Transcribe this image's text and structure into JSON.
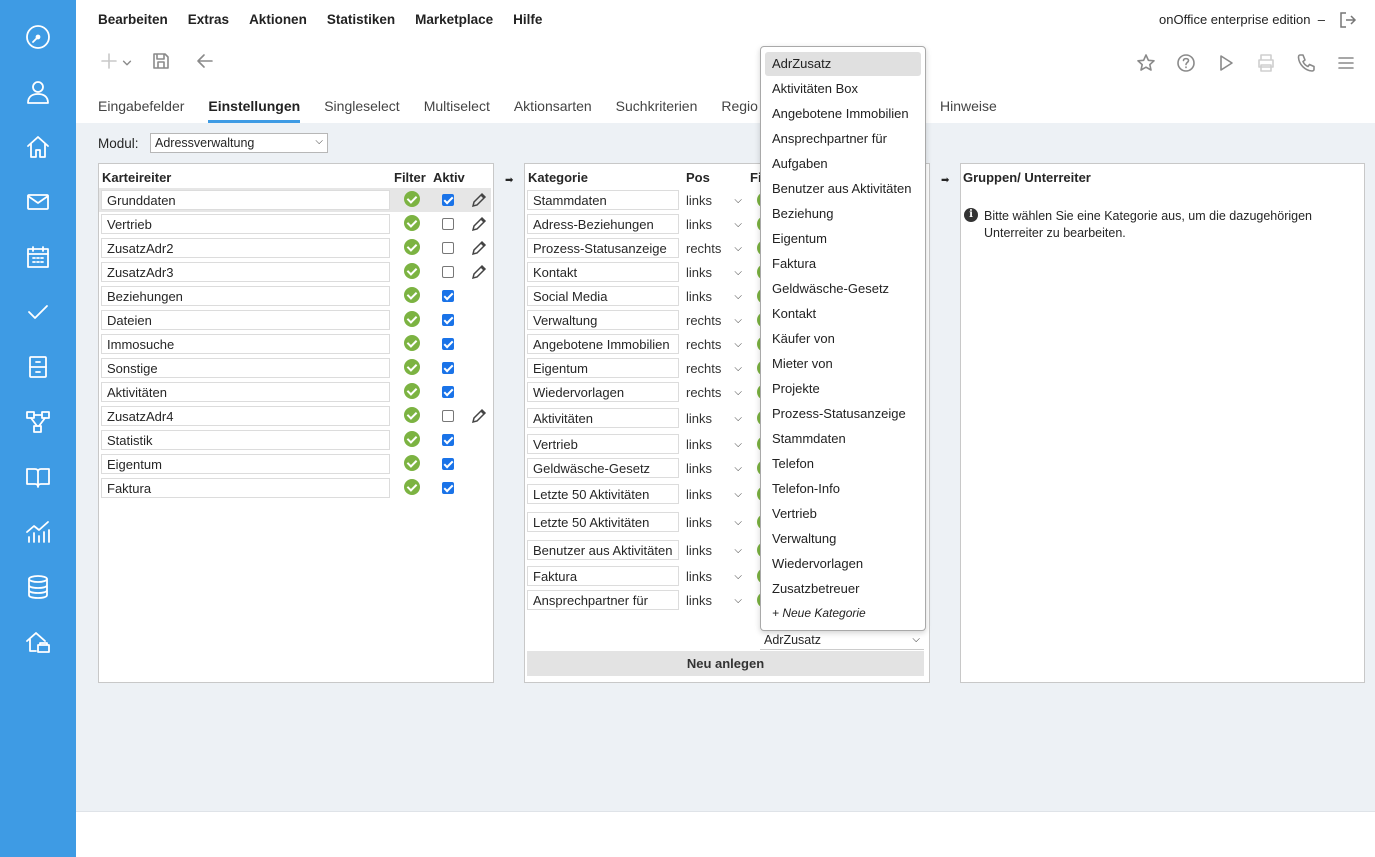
{
  "sidebar": {
    "icons": [
      "dashboard-icon",
      "user-icon",
      "home-icon",
      "mail-icon",
      "calendar-icon",
      "check-icon",
      "filing-cabinet-icon",
      "workflow-icon",
      "book-icon",
      "statistics-icon",
      "database-icon",
      "property-portal-icon"
    ]
  },
  "menu": {
    "items": [
      "Bearbeiten",
      "Extras",
      "Aktionen",
      "Statistiken",
      "Marketplace",
      "Hilfe"
    ],
    "edition": "onOffice enterprise edition",
    "edition_separator": "–"
  },
  "tabs": {
    "items": [
      "Eingabefelder",
      "Einstellungen",
      "Singleselect",
      "Multiselect",
      "Aktionsarten",
      "Suchkriterien",
      "Regio"
    ],
    "active": "Einstellungen",
    "right_item": "Hinweise"
  },
  "modul": {
    "label": "Modul:",
    "value": "Adressverwaltung"
  },
  "karteireiter": {
    "headers": {
      "name": "Karteireiter",
      "filter": "Filter",
      "aktiv": "Aktiv"
    },
    "rows": [
      {
        "name": "Grunddaten",
        "active": true,
        "editable": true
      },
      {
        "name": "Vertrieb",
        "active": false,
        "editable": true
      },
      {
        "name": "ZusatzAdr2",
        "active": false,
        "editable": true
      },
      {
        "name": "ZusatzAdr3",
        "active": false,
        "editable": true
      },
      {
        "name": "Beziehungen",
        "active": true,
        "editable": false
      },
      {
        "name": "Dateien",
        "active": true,
        "editable": false
      },
      {
        "name": "Immosuche",
        "active": true,
        "editable": false
      },
      {
        "name": "Sonstige",
        "active": true,
        "editable": false
      },
      {
        "name": "Aktivitäten",
        "active": true,
        "editable": false
      },
      {
        "name": "ZusatzAdr4",
        "active": false,
        "editable": true
      },
      {
        "name": "Statistik",
        "active": true,
        "editable": false
      },
      {
        "name": "Eigentum",
        "active": true,
        "editable": false
      },
      {
        "name": "Faktura",
        "active": true,
        "editable": false
      }
    ]
  },
  "kategorie": {
    "headers": {
      "name": "Kategorie",
      "pos": "Pos",
      "filter_partial": "Fi"
    },
    "rows": [
      {
        "name": "Stammdaten",
        "pos": "links"
      },
      {
        "name": "Adress-Beziehungen",
        "pos": "links"
      },
      {
        "name": "Prozess-Statusanzeige",
        "pos": "rechts"
      },
      {
        "name": "Kontakt",
        "pos": "links"
      },
      {
        "name": "Social Media",
        "pos": "links"
      },
      {
        "name": "Verwaltung",
        "pos": "rechts"
      },
      {
        "name": "Angebotene Immobilien",
        "pos": "rechts"
      },
      {
        "name": "Eigentum",
        "pos": "rechts"
      },
      {
        "name": "Wiedervorlagen",
        "pos": "rechts"
      },
      {
        "name": "Aktivitäten",
        "pos": "links"
      },
      {
        "name": "Vertrieb",
        "pos": "links"
      },
      {
        "name": "Geldwäsche-Gesetz",
        "pos": "links"
      },
      {
        "name": "Letzte 50 Aktivitäten",
        "pos": "links"
      },
      {
        "name": "Letzte 50 Aktivitäten",
        "pos": "links"
      },
      {
        "name": "Benutzer aus Aktivitäten",
        "pos": "links"
      },
      {
        "name": "Faktura",
        "pos": "links"
      },
      {
        "name": "Ansprechpartner für",
        "pos": "links"
      }
    ],
    "new_select_value": "AdrZusatz",
    "new_button": "Neu anlegen"
  },
  "dropdown": {
    "selected": "AdrZusatz",
    "options": [
      "AdrZusatz",
      "Aktivitäten Box",
      "Angebotene Immobilien",
      "Ansprechpartner für",
      "Aufgaben",
      "Benutzer aus Aktivitäten",
      "Beziehung",
      "Eigentum",
      "Faktura",
      "Geldwäsche-Gesetz",
      "Kontakt",
      "Käufer von",
      "Mieter von",
      "Projekte",
      "Prozess-Statusanzeige",
      "Stammdaten",
      "Telefon",
      "Telefon-Info",
      "Vertrieb",
      "Verwaltung",
      "Wiedervorlagen",
      "Zusatzbetreuer"
    ],
    "new_option": "+ Neue Kategorie"
  },
  "gruppen": {
    "header": "Gruppen/ Unterreiter",
    "info": "Bitte wählen Sie eine Kategorie aus, um die dazugehörigen Unterreiter zu bearbeiten."
  }
}
